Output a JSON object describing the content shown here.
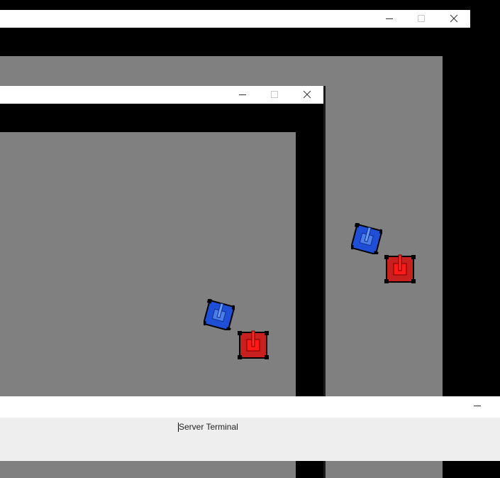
{
  "windows": {
    "back_window": {
      "controls": [
        "minimize-icon",
        "maximize-icon",
        "close-icon"
      ],
      "arena_color": "#808080"
    },
    "front_window": {
      "controls": [
        "minimize-icon",
        "maximize-icon",
        "close-icon"
      ],
      "arena_color": "#808080"
    }
  },
  "tanks": {
    "blue_color": "#1f4fd6",
    "red_color": "#c8201e"
  },
  "terminal": {
    "text": "Server Terminal",
    "controls": [
      "minimize-icon"
    ]
  }
}
